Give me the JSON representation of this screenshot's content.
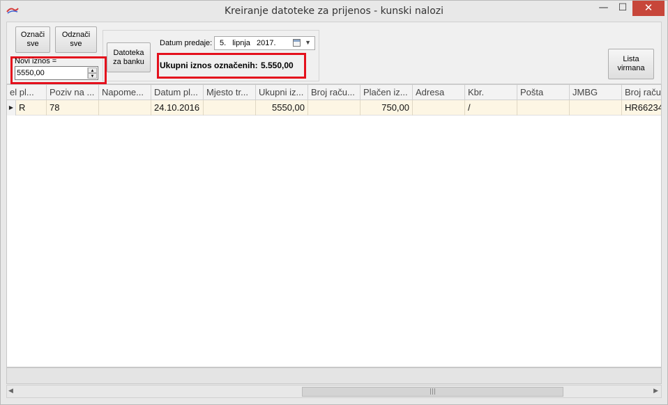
{
  "window": {
    "title": "Kreiranje datoteke za prijenos - kunski nalozi",
    "app_icon": "app-logo-icon",
    "minimize_glyph": "—",
    "maximize_glyph": "☐",
    "close_glyph": "✕"
  },
  "toolbar": {
    "oznaci_sve_label": "Označi\nsve",
    "odznaci_sve_label": "Odznači\nsve",
    "datoteka_label": "Datoteka\nza banku",
    "datum_predaje_label": "Datum predaje:",
    "datum_predaje_value": "5. lipnja 2017.",
    "novi_iznos_label": "Novi iznos =",
    "novi_iznos_value": "5550,00",
    "ukupni_label": "Ukupni iznos označenih:",
    "ukupni_value": "5.550,00",
    "lista_virmana_label": "Lista\nvirmana"
  },
  "grid": {
    "columns": [
      "el pl...",
      "Poziv na ...",
      "Napome...",
      "Datum pl...",
      "Mjesto tr...",
      "Ukupni iz...",
      "Broj raču...",
      "Plačen iz...",
      "Adresa",
      "Kbr.",
      "Pošta",
      "JMBG",
      "Broj raču"
    ],
    "rows": [
      [
        "R",
        "78",
        "",
        "24.10.2016",
        "",
        "5550,00",
        "",
        "750,00",
        "",
        "/",
        "",
        "",
        "HR66234"
      ]
    ]
  },
  "colors": {
    "highlight_border": "#e4101c",
    "selected_row": "#fdf6e4",
    "close_button": "#c7463a"
  }
}
